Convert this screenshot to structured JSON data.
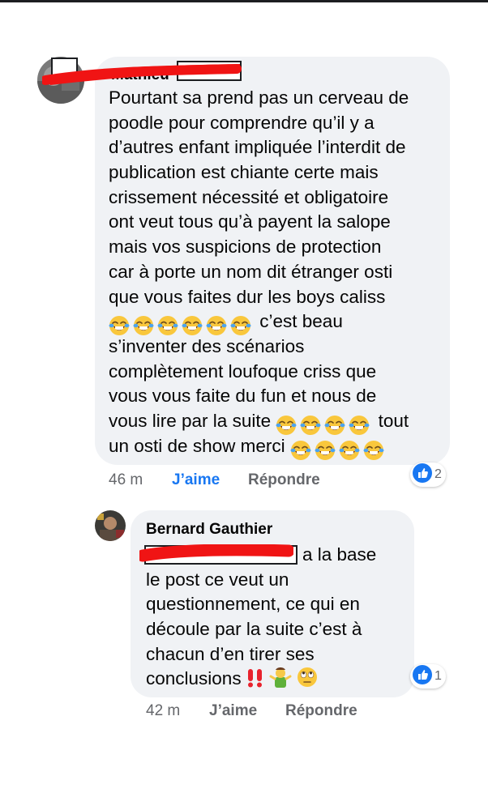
{
  "comments": [
    {
      "author": "Mathieu",
      "lines": [
        "Pourtant sa prend pas un cerveau de",
        "poodle pour comprendre qu’il y a",
        "d’autres enfant impliquée l’interdit de",
        "publication est chiante certe mais",
        "crissement nécessité et obligatoire",
        "ont veut tous qu’à payent la salope",
        "mais vos suspicions de protection",
        "car à porte un nom dit étranger osti",
        "que vous faites dur les boys caliss"
      ],
      "line10_text": "c’est beau",
      "lines_mid": [
        "s’inventer des scénarios",
        "complètement loufoque criss que",
        "vous vous faite du fun et nous de"
      ],
      "line14_text": "vous lire par la suite",
      "line14_tail": "tout",
      "line15_text": "un osti de show merci",
      "time": "46 m",
      "like_label": "J’aime",
      "reply_label": "Répondre",
      "reaction_count": "2",
      "reaction_icon": "like-thumb-icon",
      "emoji_icon": "face-with-tears-of-joy-icon"
    },
    {
      "author": "Bernard Gauthier",
      "first_line_tail": "a la base",
      "lines": [
        "le post ce veut un",
        "questionnement, ce qui en",
        "découle par la suite c’est à",
        "chacun d’en tirer ses"
      ],
      "last_line": "conclusions",
      "time": "42 m",
      "like_label": "J’aime",
      "reply_label": "Répondre",
      "reaction_count": "1",
      "reaction_icon": "like-thumb-icon"
    }
  ],
  "colors": {
    "bubble": "#f0f2f5",
    "like_active": "#1877f2",
    "meta": "#65676b",
    "redaction": "#f01414"
  }
}
